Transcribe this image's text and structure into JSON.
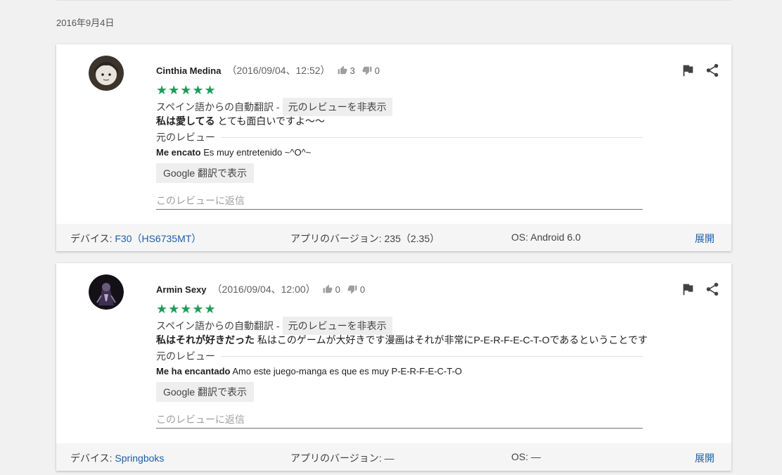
{
  "date_header": "2016年9月4日",
  "reviews": [
    {
      "author": "Cinthia Medina",
      "datetime": "（2016/09/04、12:52）",
      "thumbs_up": "3",
      "thumbs_down": "0",
      "stars": "★★★★★",
      "rating": 5,
      "translation_label": "スペイン語からの自動翻訳 -",
      "hide_original_label": "元のレビューを非表示",
      "translated_title": "私は愛してる",
      "translated_body": " とても面白いですよ〜〜",
      "original_label": "元のレビュー",
      "original_title": "Me encato",
      "original_body": " Es muy entretenido ~^O^~",
      "gt_button": "Google 翻訳で表示",
      "reply_placeholder": "このレビューに返信",
      "device_label": "デバイス: ",
      "device_value": "F30（HS6735MT）",
      "app_version": "アプリのバージョン: 235（2.35）",
      "os": "OS: Android 6.0",
      "expand": "展開"
    },
    {
      "author": "Armin Sexy",
      "datetime": "（2016/09/04、12:00）",
      "thumbs_up": "0",
      "thumbs_down": "0",
      "stars": "★★★★★",
      "rating": 5,
      "translation_label": "スペイン語からの自動翻訳 -",
      "hide_original_label": "元のレビューを非表示",
      "translated_title": "私はそれが好きだった",
      "translated_body": " 私はこのゲームが大好きです漫画はそれが非常にP-E-R-F-E-C-T-Oであるということです",
      "original_label": "元のレビュー",
      "original_title": "Me ha encantado",
      "original_body": " Amo este juego-manga es que es muy P-E-R-F-E-C-T-O",
      "gt_button": "Google 翻訳で表示",
      "reply_placeholder": "このレビューに返信",
      "device_label": "デバイス: ",
      "device_value": "Springboks",
      "app_version": "アプリのバージョン: ―",
      "os": "OS: ―",
      "expand": "展開"
    }
  ],
  "icons": {
    "thumb_up": "thumb-up-icon",
    "thumb_down": "thumb-down-icon",
    "flag": "flag-icon",
    "share": "share-icon"
  },
  "colors": {
    "star": "#1e9d58",
    "link": "#1a5fa8",
    "background": "#f1f1f1"
  }
}
